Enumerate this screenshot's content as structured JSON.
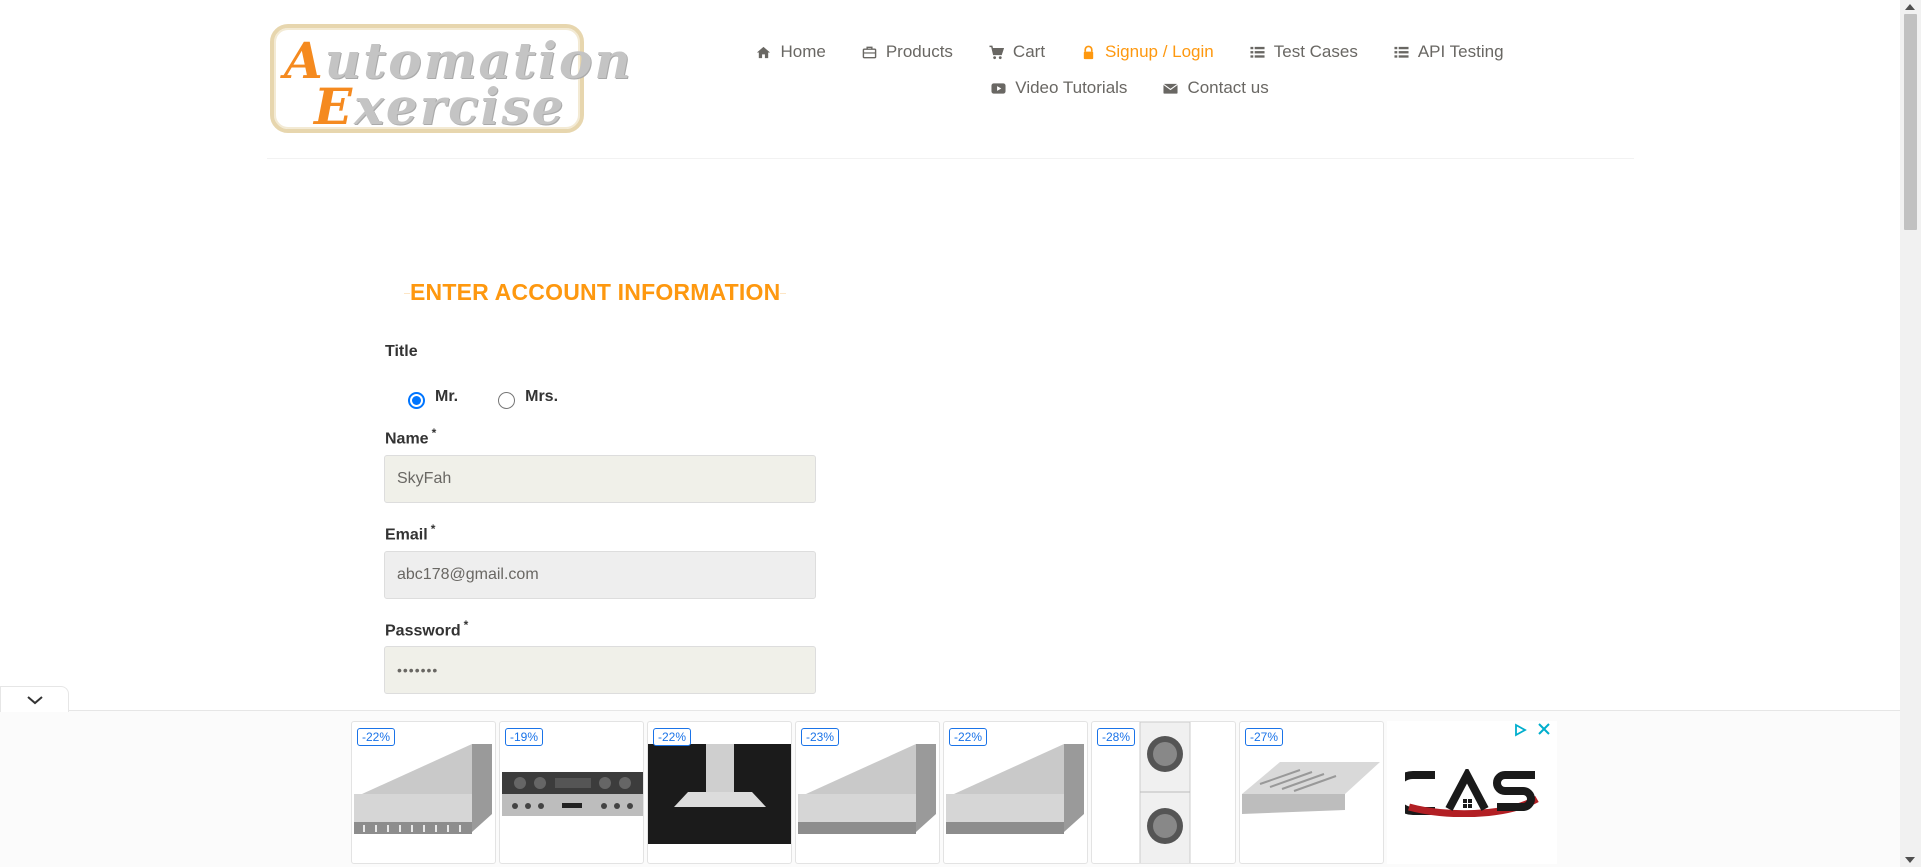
{
  "logo": {
    "line1_cap": "A",
    "line1_rest": "utomation",
    "line2_cap": "E",
    "line2_rest": "xercise"
  },
  "nav": {
    "row1": [
      {
        "label": "Home",
        "icon": "home-icon"
      },
      {
        "label": "Products",
        "icon": "briefcase-icon"
      },
      {
        "label": "Cart",
        "icon": "cart-icon"
      },
      {
        "label": "Signup / Login",
        "icon": "lock-icon",
        "active": true
      },
      {
        "label": "Test Cases",
        "icon": "list-icon"
      },
      {
        "label": "API Testing",
        "icon": "list-icon"
      }
    ],
    "row2": [
      {
        "label": "Video Tutorials",
        "icon": "youtube-play-icon"
      },
      {
        "label": "Contact us",
        "icon": "envelope-icon"
      }
    ]
  },
  "form": {
    "heading": "ENTER ACCOUNT INFORMATION",
    "title_label": "Title",
    "title_options": [
      {
        "label": "Mr.",
        "checked": true
      },
      {
        "label": "Mrs.",
        "checked": false
      }
    ],
    "name_label": "Name",
    "name_value": "SkyFah",
    "email_label": "Email",
    "email_value": "abc178@gmail.com",
    "password_label": "Password",
    "password_value": "•••••••",
    "required_mark": "*"
  },
  "ads": {
    "badges": [
      "-22%",
      "-19%",
      "-22%",
      "-23%",
      "-22%",
      "-28%",
      "-27%"
    ],
    "accent_color": "#1a73e8"
  },
  "colors": {
    "accent": "#fe980f",
    "text": "#696763"
  }
}
